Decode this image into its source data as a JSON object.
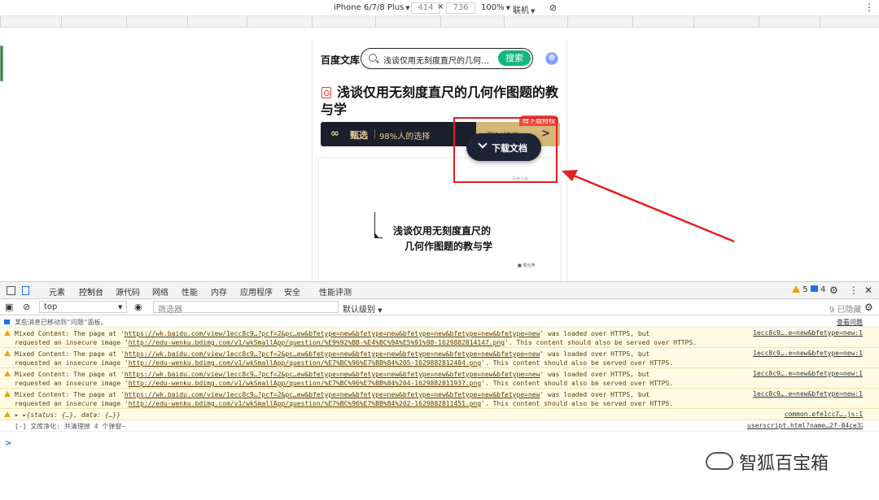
{
  "device_toolbar": {
    "device": "iPhone 6/7/8 Plus",
    "width": "414",
    "times": "×",
    "height": "736",
    "zoom": "100%",
    "network": "联机"
  },
  "page": {
    "logo": "百度文库",
    "search_query": "浅谈仅用无刻度直尺的几何作图题的教与学",
    "search_button": "搜索",
    "doc_title": "浅谈仅用无刻度直尺的几何作图题的教与学",
    "vip_select": "甄选",
    "vip_percent": "98%人的选择",
    "vip_hidden_text": "限时特惠VIP",
    "vip_arrow": ">",
    "tag": "赠下载特权",
    "download_button": "下载文档",
    "card_line1": "浅谈仅用无刻度直尺的",
    "card_line2": "几何作图题的教与学",
    "card_stamp": "百度文库",
    "card_author": "■ 周元萍"
  },
  "devtools": {
    "tabs": [
      "元素",
      "控制台",
      "源代码",
      "网络",
      "性能",
      "内存",
      "应用程序",
      "安全",
      "性能评测"
    ],
    "active_tab": "控制台",
    "warn_count": "5",
    "msg_count": "4",
    "context": "top",
    "filter_placeholder": "筛选器",
    "level": "默认级别",
    "hidden": "9 已隐藏",
    "moved_msg": "某些消息已移动到\"问题\"面板。",
    "view_issues": "查看问题",
    "messages": [
      {
        "line1_pre": "Mixed Content: The page at '",
        "url1": "https://wk.baidu.com/view/1ecc8c9…?pcf=2&pc…ew&bfetype=new&bfetype=new&bfetype=new&bfetype=new&bfetype=new",
        "line1_post": "' was loaded over HTTPS, but",
        "line2_pre": "requested an insecure image '",
        "url2": "http://edu-wenku.bdimg.com/v1/wkSmallApp/question/%E9%92%BB-%E4%BC%9A%E5%91%98-1629882814147.png",
        "line2_post": "'. This content should also be served over HTTPS.",
        "source": "1ecc8c9….e=new&bfetype=new:1"
      },
      {
        "line1_pre": "Mixed Content: The page at '",
        "url1": "https://wk.baidu.com/view/1ecc8c9…?pcf=2&pc…ew&bfetype=new&bfetype=new&bfetype=new&bfetype=new&bfetype=new",
        "line1_post": "' was loaded over HTTPS, but",
        "line2_pre": "requested an insecure image '",
        "url2": "http://edu-wenku.bdimg.com/v1/wkSmallApp/question/%E7%BC%96%E7%BB%84%205-1629882812484.png",
        "line2_post": "'. This content should also be served over HTTPS.",
        "source": "1ecc8c9….e=new&bfetype=new:1"
      },
      {
        "line1_pre": "Mixed Content: The page at '",
        "url1": "https://wk.baidu.com/view/1ecc8c9…?pcf=2&pc…ew&bfetype=new&bfetype=new&bfetype=new&bfetype=new&bfetype=new",
        "line1_post": "' was loaded over HTTPS, but",
        "line2_pre": "requested an insecure image '",
        "url2": "http://edu-wenku.bdimg.com/v1/wkSmallApp/question/%E7%BC%96%E7%BB%84%204-1629882811937.png",
        "line2_post": "'. This content should also be served over HTTPS.",
        "source": "1ecc8c9….e=new&bfetype=new:1"
      },
      {
        "line1_pre": "Mixed Content: The page at '",
        "url1": "https://wk.baidu.com/view/1ecc8c9…?pcf=2&pc…ew&bfetype=new&bfetype=new&bfetype=new&bfetype=new&bfetype=new",
        "line1_post": "' was loaded over HTTPS, but",
        "line2_pre": "requested an insecure image '",
        "url2": "http://edu-wenku.bdimg.com/v1/wkSmallApp/question/%E7%BC%96%E7%BB%84%202-1629882811451.png",
        "line2_post": "'. This content should also be served over HTTPS.",
        "source": "1ecc8c9….e=new&bfetype=new:1"
      }
    ],
    "object_log": "▸ ▸{status: {…}, data: {…}}",
    "object_source": "common.efe1cc7….js:1",
    "info_log": "[-] 文库净化: 共清理掉 4 个弹窗~",
    "info_source": "userscript.html?name…2f-84ce32c1bd61:122",
    "prompt": ">"
  },
  "watermark": "智狐百宝箱",
  "colors": {
    "search_green": "#14b681",
    "annotation_red": "#e02020",
    "warn_bg": "#fffbe5",
    "vip_gold": "#d7b67a"
  }
}
